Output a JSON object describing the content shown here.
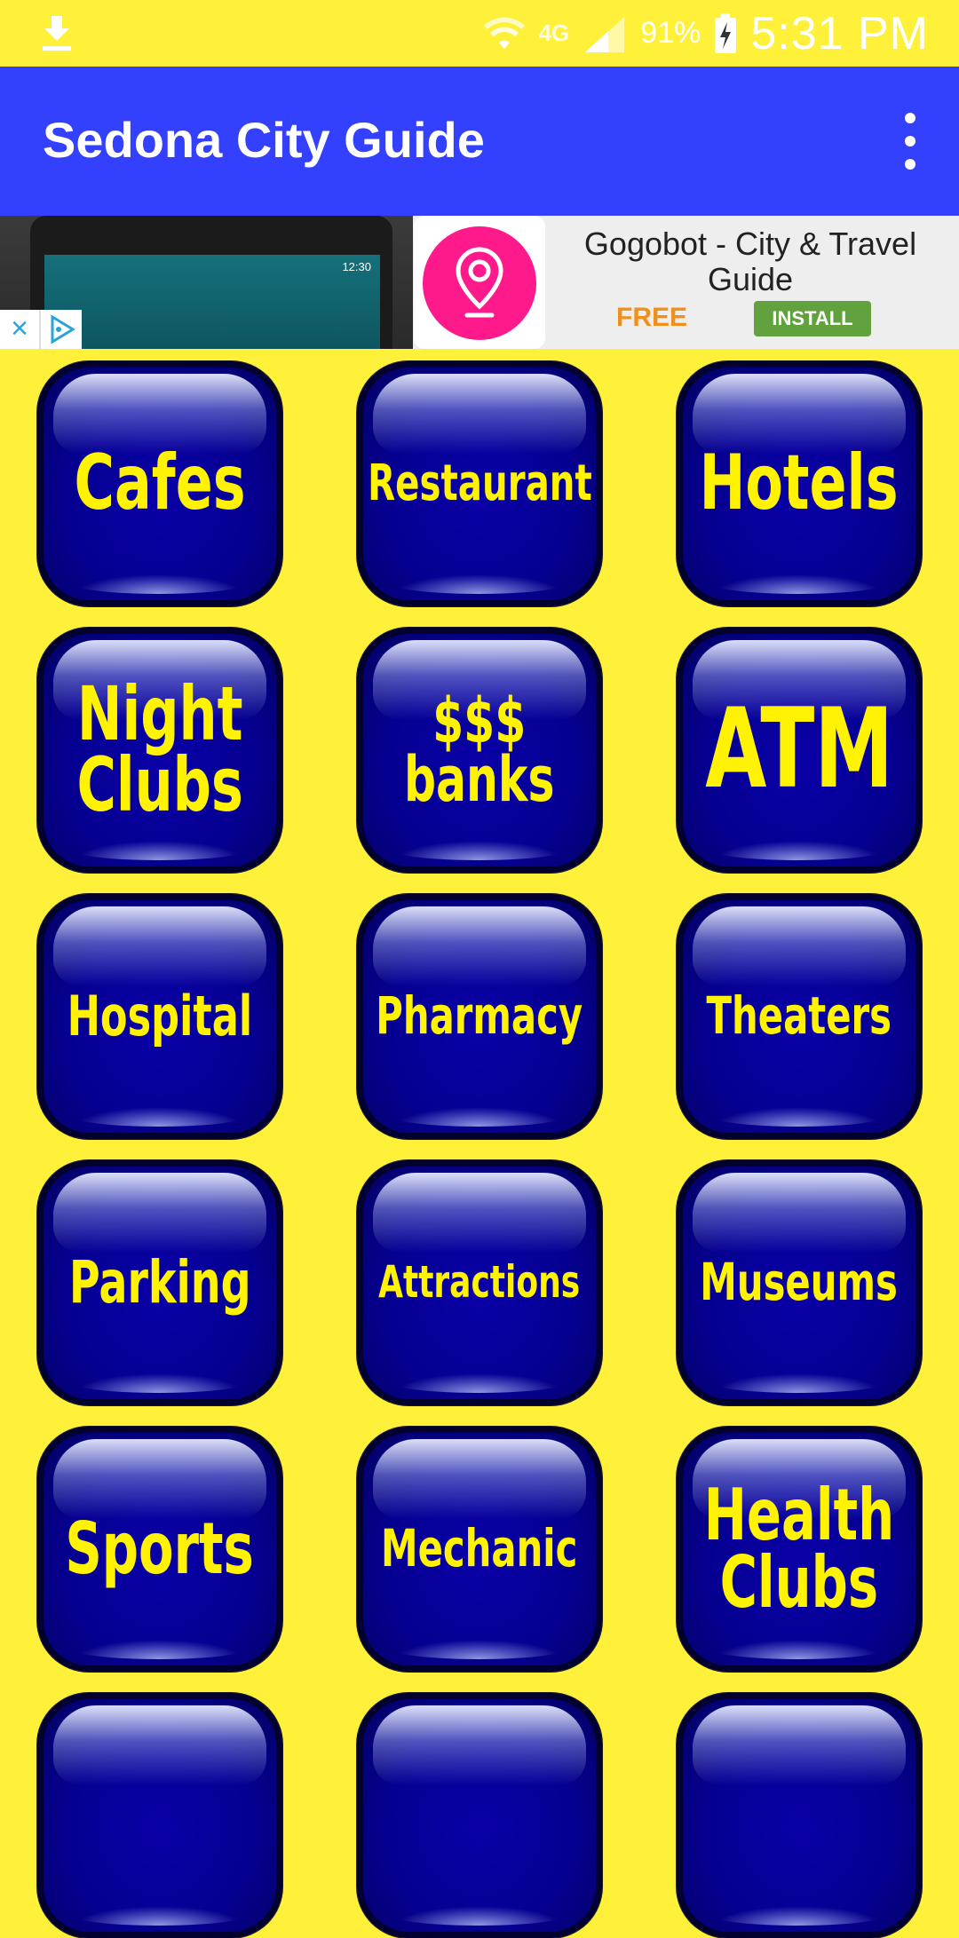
{
  "status_bar": {
    "battery_percent": "91%",
    "time": "5:31 PM",
    "network": "4G"
  },
  "app_bar": {
    "title": "Sedona City Guide",
    "menu_icon": "more-vert-icon"
  },
  "ad": {
    "preview_time": "12:30",
    "title": "Gogobot - City & Travel Guide",
    "price": "FREE",
    "install_label": "INSTALL",
    "icon": "location-pin-icon",
    "icon_color": "#FF1A8C"
  },
  "theme": {
    "background": "#FFF03A",
    "app_bar": "#3341FF",
    "tile": "#0A00A8",
    "tile_text": "#FFF203"
  },
  "tiles": [
    {
      "label": "Cafes"
    },
    {
      "label": "Restaurant"
    },
    {
      "label": "Hotels"
    },
    {
      "label": "Night\nClubs"
    },
    {
      "label": "$$$\nbanks"
    },
    {
      "label": "ATM"
    },
    {
      "label": "Hospital"
    },
    {
      "label": "Pharmacy"
    },
    {
      "label": "Theaters"
    },
    {
      "label": "Parking"
    },
    {
      "label": "Attractions"
    },
    {
      "label": "Museums"
    },
    {
      "label": "Sports"
    },
    {
      "label": "Mechanic"
    },
    {
      "label": "Health\nClubs"
    }
  ]
}
